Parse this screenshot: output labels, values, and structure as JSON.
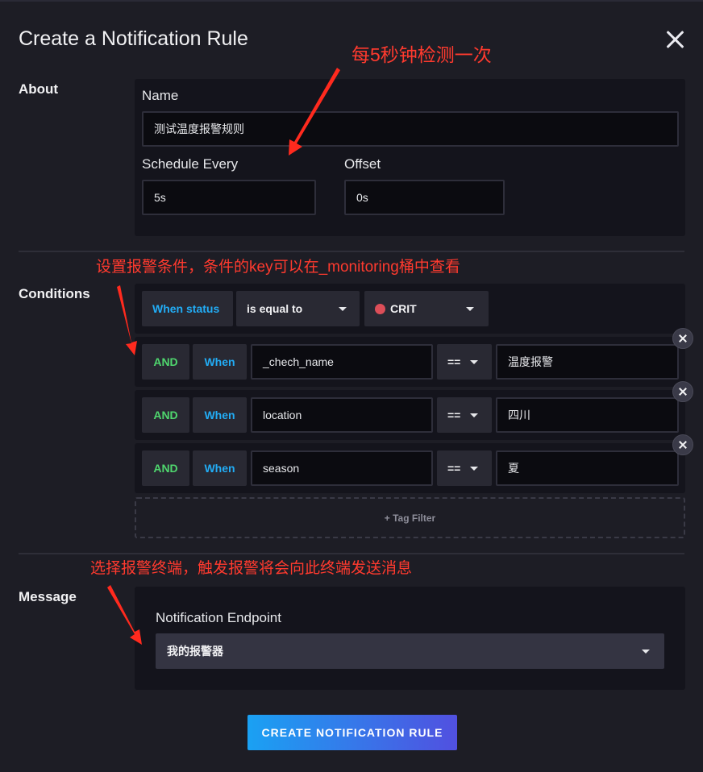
{
  "dialog": {
    "title": "Create a Notification Rule"
  },
  "about": {
    "section_label": "About",
    "name_label": "Name",
    "name_value": "测试温度报警规则",
    "schedule_label": "Schedule Every",
    "schedule_value": "5s",
    "offset_label": "Offset",
    "offset_value": "0s"
  },
  "conditions": {
    "section_label": "Conditions",
    "status": {
      "when_label": "When status",
      "operator": "is equal to",
      "level": "CRIT",
      "level_color": "#dc4e58"
    },
    "tag_rows": [
      {
        "and_label": "AND",
        "when_label": "When",
        "key": "_chech_name",
        "operator": "==",
        "value": "温度报警"
      },
      {
        "and_label": "AND",
        "when_label": "When",
        "key": "location",
        "operator": "==",
        "value": "四川"
      },
      {
        "and_label": "AND",
        "when_label": "When",
        "key": "season",
        "operator": "==",
        "value": "夏"
      }
    ],
    "tag_filter_label": "+ Tag Filter"
  },
  "message": {
    "section_label": "Message",
    "endpoint_label": "Notification Endpoint",
    "endpoint_value": "我的报警器"
  },
  "submit_label": "CREATE NOTIFICATION RULE",
  "annotations": {
    "schedule_note": "每5秒钟检测一次",
    "conditions_note": "设置报警条件，条件的key可以在_monitoring桶中查看",
    "message_note": "选择报警终端，触发报警将会向此终端发送消息",
    "color": "#ff3a2e"
  },
  "colors": {
    "background": "#1d1d25",
    "panel": "#14141c",
    "accent_blue": "#22adf6",
    "accent_green": "#4fd66e"
  }
}
